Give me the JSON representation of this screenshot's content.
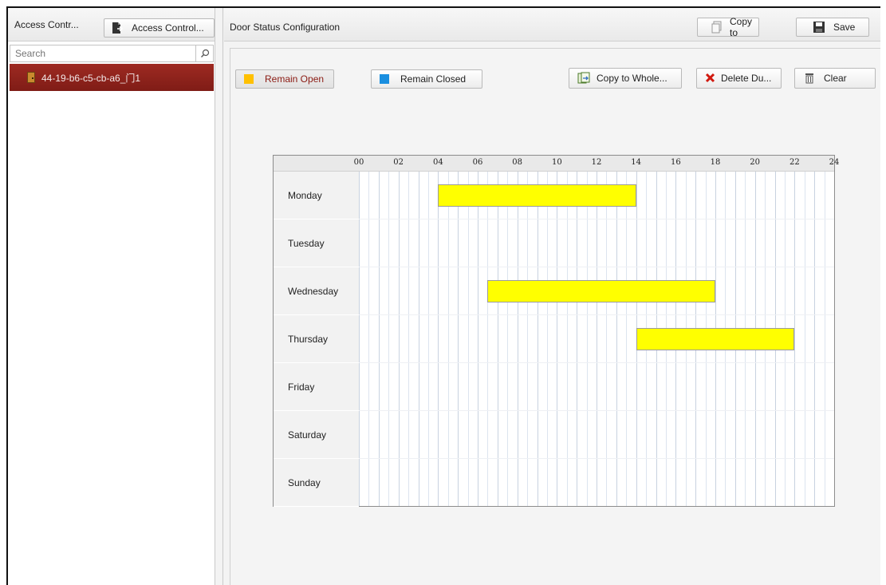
{
  "left_panel": {
    "title": "Access Contr...",
    "access_control_button": "Access Control...",
    "search_placeholder": "Search",
    "tree_items": [
      {
        "label": "44-19-b6-c5-cb-a6_门1",
        "selected": true
      }
    ]
  },
  "right_panel": {
    "title": "Door Status Configuration",
    "copy_to_label": "Copy to",
    "save_label": "Save"
  },
  "toolbar": {
    "remain_open": {
      "label": "Remain Open",
      "color": "#ffc000"
    },
    "remain_closed": {
      "label": "Remain Closed",
      "color": "#1a8fe0"
    },
    "copy_whole_label": "Copy to Whole...",
    "delete_label": "Delete Du...",
    "clear_label": "Clear"
  },
  "schedule": {
    "hours": [
      "00",
      "02",
      "04",
      "06",
      "08",
      "10",
      "12",
      "14",
      "16",
      "18",
      "20",
      "22",
      "24"
    ],
    "days": [
      {
        "name": "Monday",
        "segments": [
          {
            "start": 4,
            "end": 14,
            "status": "Remain Open"
          }
        ]
      },
      {
        "name": "Tuesday",
        "segments": []
      },
      {
        "name": "Wednesday",
        "segments": [
          {
            "start": 6.5,
            "end": 18,
            "status": "Remain Open"
          }
        ]
      },
      {
        "name": "Thursday",
        "segments": [
          {
            "start": 14,
            "end": 22,
            "status": "Remain Open"
          }
        ]
      },
      {
        "name": "Friday",
        "segments": []
      },
      {
        "name": "Saturday",
        "segments": []
      },
      {
        "name": "Sunday",
        "segments": []
      }
    ],
    "open_color": "#ffff00"
  }
}
